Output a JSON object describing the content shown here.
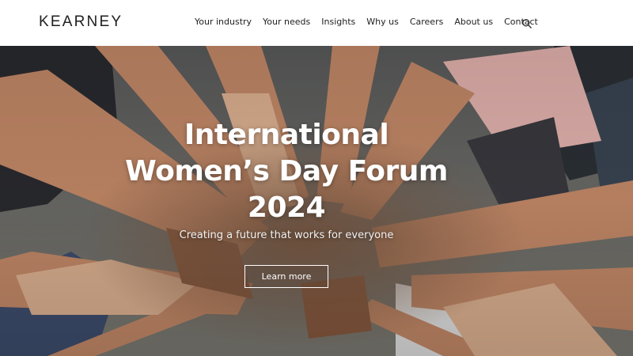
{
  "header": {
    "logo": "KEARNEY",
    "nav": [
      "Your industry",
      "Your needs",
      "Insights",
      "Why us",
      "Careers",
      "About us",
      "Contact"
    ],
    "search_icon": "search-icon"
  },
  "hero": {
    "title_lines": [
      "International",
      "Women’s Day Forum",
      "2024"
    ],
    "subtitle": "Creating a future that works for everyone",
    "cta_label": "Learn more",
    "image": "hands stacked together in a circle"
  },
  "colors": {
    "header_bg": "#ffffff",
    "text_dark": "#222222",
    "hero_text": "#ffffff"
  }
}
